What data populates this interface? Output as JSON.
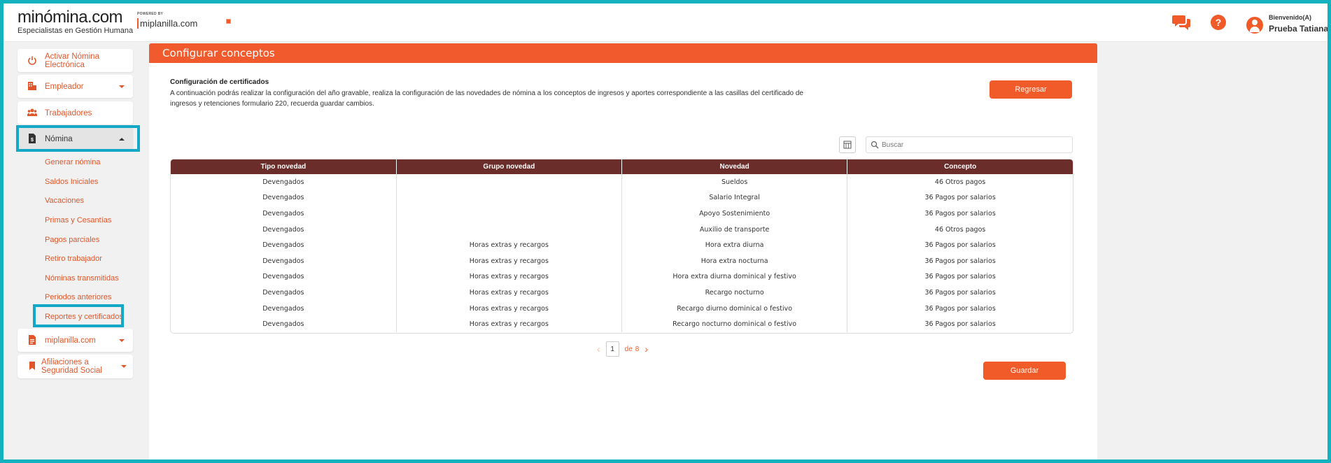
{
  "header": {
    "logo_main": "minómina.com",
    "logo_sub": "Especialistas en Gestión Humana",
    "powered_label": "POWERED BY",
    "powered_name": "miplanilla.com",
    "user_greeting": "Bienvenido(A)",
    "user_name": "Prueba Tatiana"
  },
  "sidebar": {
    "items": [
      {
        "label": "Activar Nómina Electrónica",
        "icon": "power-icon"
      },
      {
        "label": "Empleador",
        "icon": "building-icon"
      },
      {
        "label": "Trabajadores",
        "icon": "users-icon"
      },
      {
        "label": "Nómina",
        "icon": "payroll-document-icon"
      },
      {
        "label": "miplanilla.com",
        "icon": "document-icon"
      },
      {
        "label": "Afiliaciones a Seguridad Social",
        "icon": "bookmark-icon"
      }
    ],
    "nomina_sub": [
      "Generar nómina",
      "Saldos Iniciales",
      "Vacaciones",
      "Primas y Cesantías",
      "Pagos parciales",
      "Retiro trabajador",
      "Nóminas transmitidas",
      "Periodos anteriores",
      "Reportes y certificados"
    ]
  },
  "main": {
    "title": "Configurar conceptos",
    "section_title": "Configuración de certificados",
    "description": "A continuación podrás realizar la configuración del año gravable, realiza la configuración de las novedades de nómina a los conceptos de ingresos y aportes correspondiente a las casillas del certificado de ingresos y retenciones formulario 220, recuerda guardar cambios.",
    "back_button": "Regresar",
    "save_button": "Guardar",
    "search_placeholder": "Buscar",
    "table": {
      "headers": [
        "Tipo novedad",
        "Grupo novedad",
        "Novedad",
        "Concepto"
      ],
      "rows": [
        [
          "Devengados",
          "",
          "Sueldos",
          "46 Otros pagos"
        ],
        [
          "Devengados",
          "",
          "Salario Integral",
          "36 Pagos por salarios"
        ],
        [
          "Devengados",
          "",
          "Apoyo Sostenimiento",
          "36 Pagos por salarios"
        ],
        [
          "Devengados",
          "",
          "Auxilio de transporte",
          "46 Otros pagos"
        ],
        [
          "Devengados",
          "Horas extras y recargos",
          "Hora extra diurna",
          "36 Pagos por salarios"
        ],
        [
          "Devengados",
          "Horas extras y recargos",
          "Hora extra nocturna",
          "36 Pagos por salarios"
        ],
        [
          "Devengados",
          "Horas extras y recargos",
          "Hora extra diurna dominical y festivo",
          "36 Pagos por salarios"
        ],
        [
          "Devengados",
          "Horas extras y recargos",
          "Recargo nocturno",
          "36 Pagos por salarios"
        ],
        [
          "Devengados",
          "Horas extras y recargos",
          "Recargo diurno dominical o festivo",
          "36 Pagos por salarios"
        ],
        [
          "Devengados",
          "Horas extras y recargos",
          "Recargo nocturno dominical o festivo",
          "36 Pagos por salarios"
        ]
      ]
    },
    "pager": {
      "current": "1",
      "of_label": "de",
      "total": "8"
    }
  },
  "colors": {
    "accent": "#f15a29",
    "table_header": "#6b2d2a",
    "highlight": "#14a8c8"
  }
}
